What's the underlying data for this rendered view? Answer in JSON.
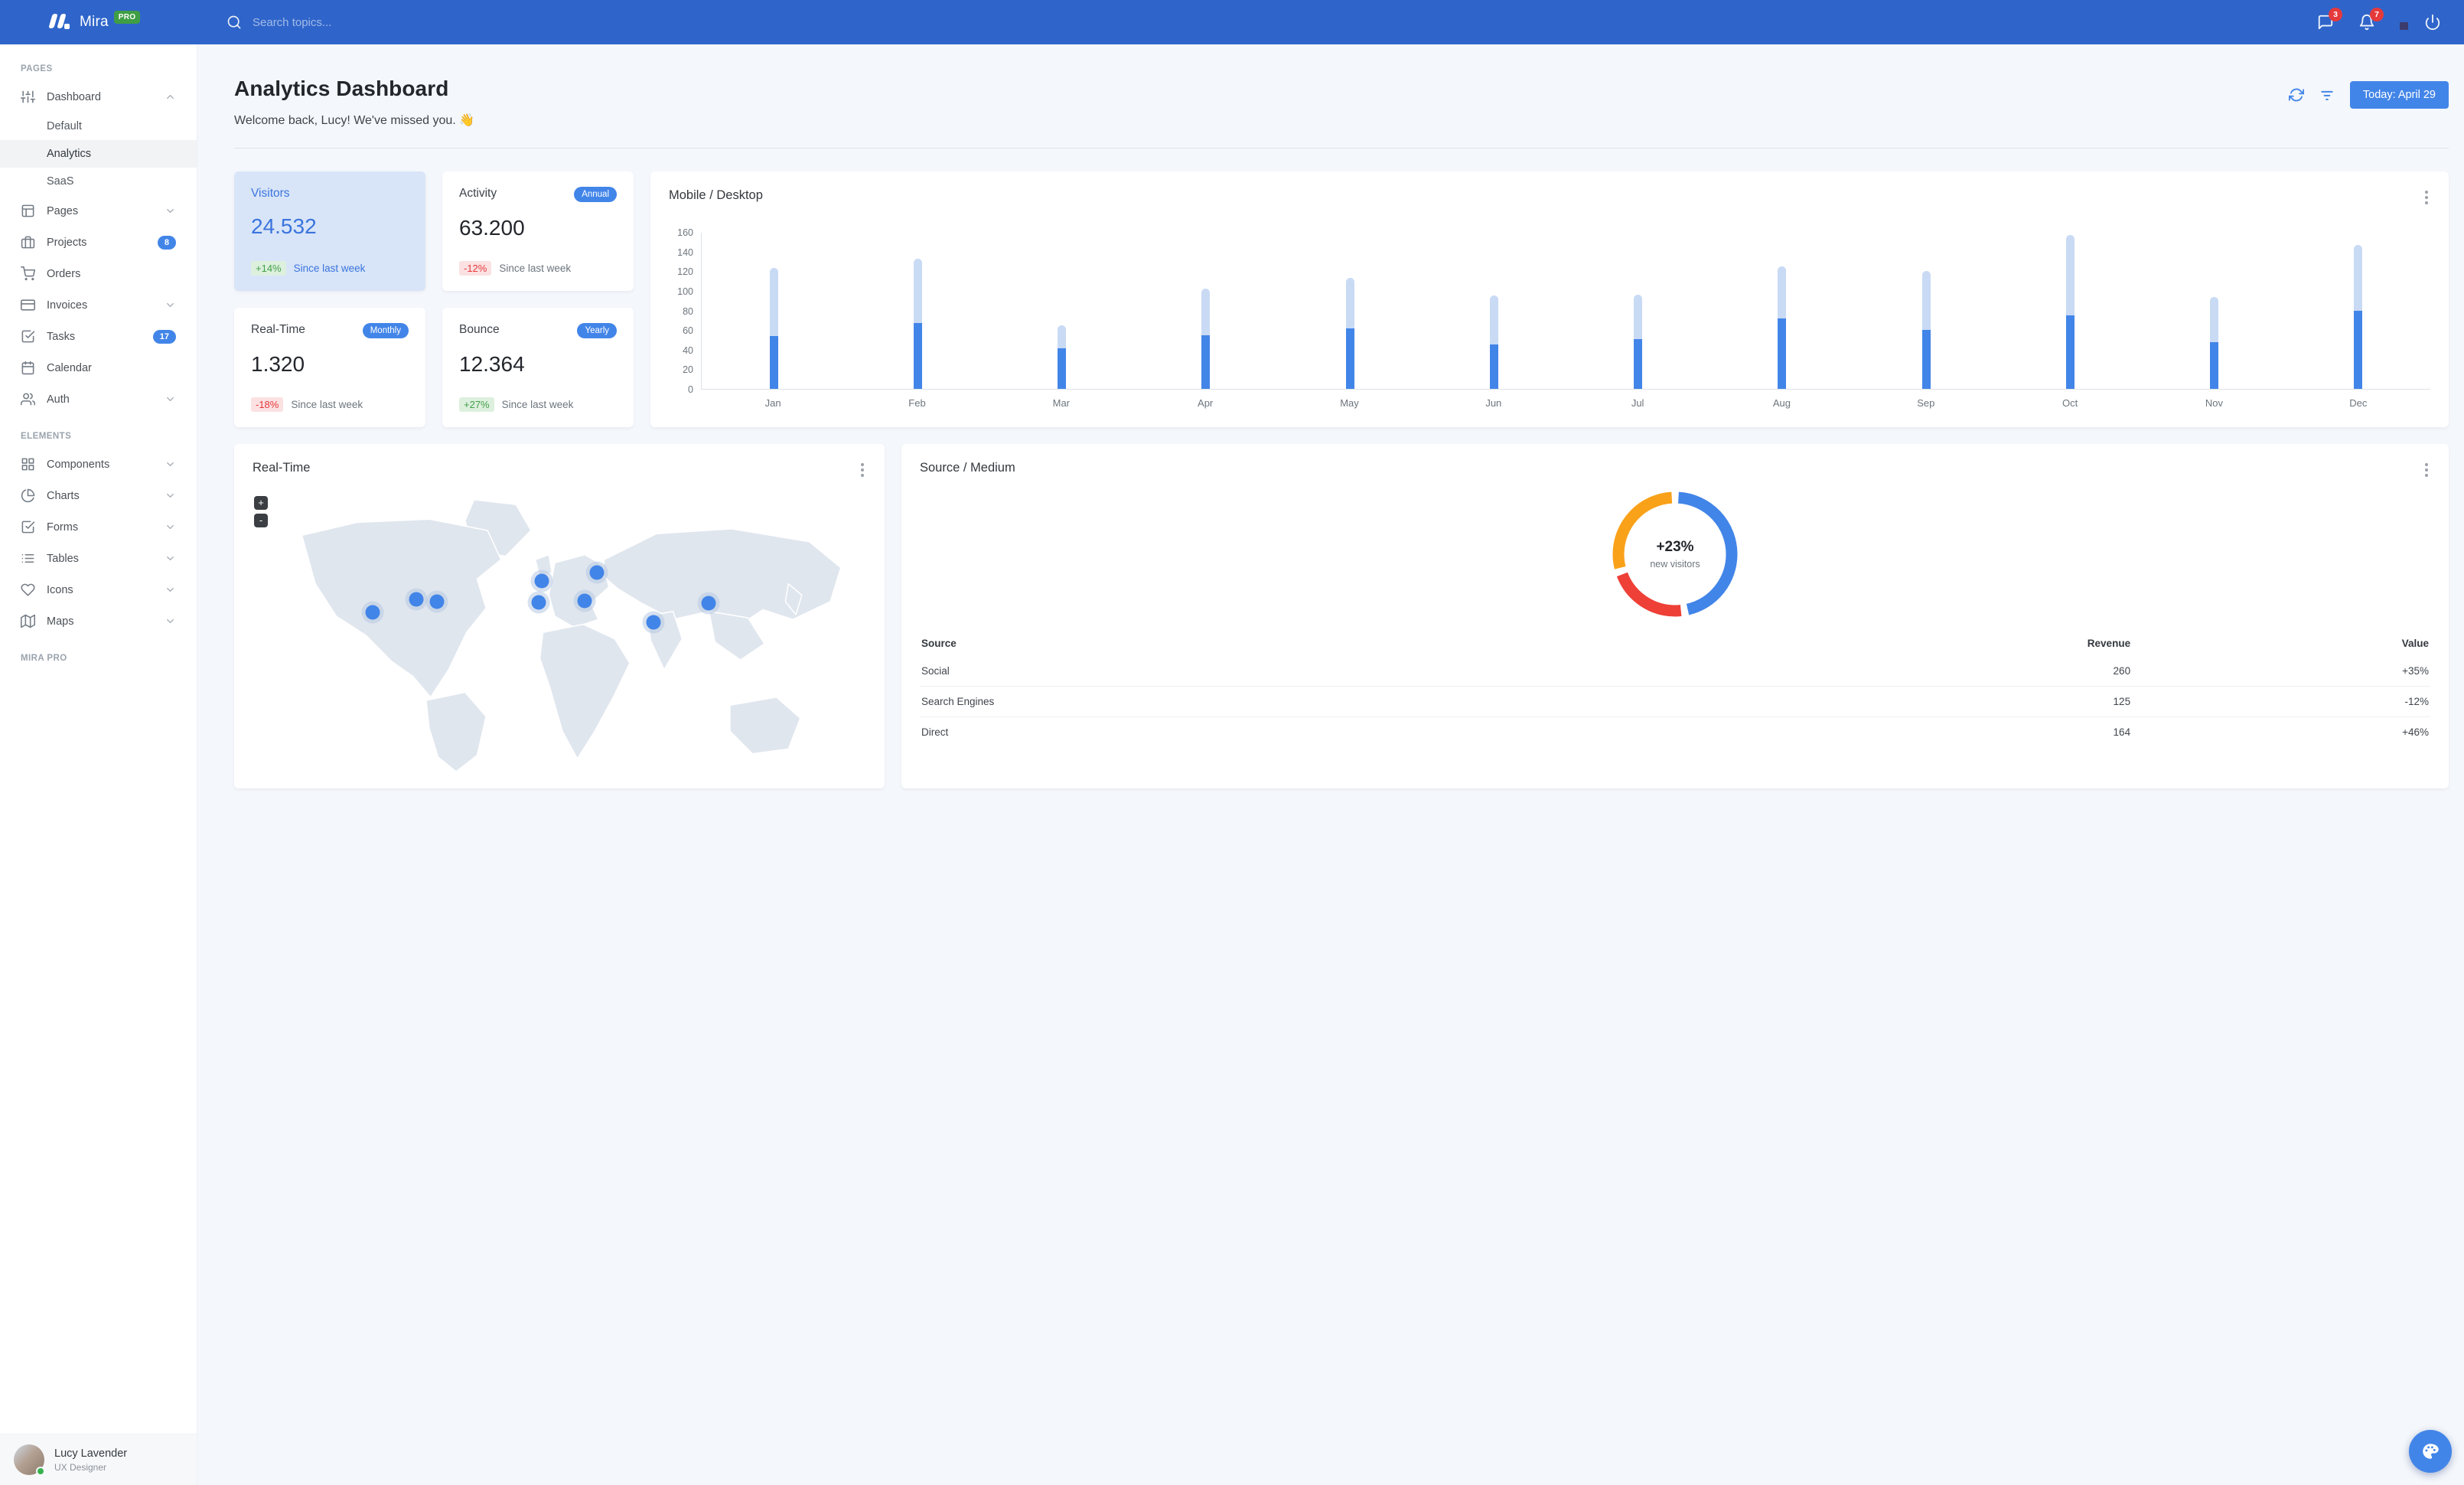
{
  "theme": {
    "primary": "#4285e8",
    "navbar": "#2f65ca",
    "success": "#47b14d",
    "danger": "#e5393c",
    "warning": "#f9a119"
  },
  "navbar": {
    "brand": "Mira",
    "brand_badge": "PRO",
    "search_placeholder": "Search topics...",
    "messages_count": "3",
    "notifications_count": "7"
  },
  "sidebar": {
    "sections": [
      {
        "label": "PAGES",
        "items": [
          {
            "icon": "sliders-icon",
            "label": "Dashboard",
            "chevron": "up",
            "children": [
              {
                "label": "Default",
                "active": false
              },
              {
                "label": "Analytics",
                "active": true
              },
              {
                "label": "SaaS",
                "active": false
              }
            ]
          },
          {
            "icon": "layout-icon",
            "label": "Pages",
            "chevron": "down"
          },
          {
            "icon": "briefcase-icon",
            "label": "Projects",
            "badge": "8"
          },
          {
            "icon": "cart-icon",
            "label": "Orders"
          },
          {
            "icon": "credit-card-icon",
            "label": "Invoices",
            "chevron": "down"
          },
          {
            "icon": "check-square-icon",
            "label": "Tasks",
            "badge": "17"
          },
          {
            "icon": "calendar-icon",
            "label": "Calendar"
          },
          {
            "icon": "users-icon",
            "label": "Auth",
            "chevron": "down"
          }
        ]
      },
      {
        "label": "ELEMENTS",
        "items": [
          {
            "icon": "grid-icon",
            "label": "Components",
            "chevron": "down"
          },
          {
            "icon": "pie-chart-icon",
            "label": "Charts",
            "chevron": "down"
          },
          {
            "icon": "check-square-icon",
            "label": "Forms",
            "chevron": "down"
          },
          {
            "icon": "list-icon",
            "label": "Tables",
            "chevron": "down"
          },
          {
            "icon": "heart-icon",
            "label": "Icons",
            "chevron": "down"
          },
          {
            "icon": "map-icon",
            "label": "Maps",
            "chevron": "down"
          }
        ]
      },
      {
        "label": "MIRA PRO",
        "items": []
      }
    ],
    "user": {
      "name": "Lucy Lavender",
      "role": "UX Designer"
    }
  },
  "header": {
    "title": "Analytics Dashboard",
    "welcome": "Welcome back, Lucy! We've missed you. 👋",
    "date_button": "Today: April 29"
  },
  "stats": [
    {
      "title": "Visitors",
      "value": "24.532",
      "delta": "+14%",
      "delta_dir": "up",
      "note": "Since last week",
      "highlight": true
    },
    {
      "title": "Activity",
      "badge": "Annual",
      "value": "63.200",
      "delta": "-12%",
      "delta_dir": "down",
      "note": "Since last week",
      "highlight": false
    },
    {
      "title": "Real-Time",
      "badge": "Monthly",
      "value": "1.320",
      "delta": "-18%",
      "delta_dir": "down",
      "note": "Since last week",
      "highlight": false
    },
    {
      "title": "Bounce",
      "badge": "Yearly",
      "value": "12.364",
      "delta": "+27%",
      "delta_dir": "up",
      "note": "Since last week",
      "highlight": false
    }
  ],
  "chart_data": [
    {
      "type": "bar",
      "stacked": true,
      "title": "Mobile / Desktop",
      "categories": [
        "Jan",
        "Feb",
        "Mar",
        "Apr",
        "May",
        "Jun",
        "Jul",
        "Aug",
        "Sep",
        "Oct",
        "Nov",
        "Dec"
      ],
      "series": [
        {
          "name": "Mobile",
          "color": "#4285e8",
          "values": [
            54,
            67,
            41,
            55,
            62,
            45,
            51,
            72,
            60,
            75,
            48,
            80
          ]
        },
        {
          "name": "Desktop",
          "color": "#c9daf5",
          "values": [
            69,
            66,
            24,
            47,
            51,
            50,
            45,
            53,
            60,
            82,
            46,
            67
          ]
        }
      ],
      "xlabel": "",
      "ylabel": "",
      "ylim": [
        0,
        160
      ],
      "ytick_step": 20,
      "grid": false,
      "legend": "none"
    },
    {
      "type": "donut",
      "title": "Source / Medium",
      "center_value": "+23%",
      "center_label": "new visitors",
      "slices": [
        {
          "label": "Social",
          "value": 260,
          "color": "#4285e8"
        },
        {
          "label": "Search Engines",
          "value": 125,
          "color": "#ee4037"
        },
        {
          "label": "Direct",
          "value": 164,
          "color": "#f9a119"
        }
      ],
      "legend": "none"
    }
  ],
  "map_card": {
    "title": "Real-Time",
    "zoom_in": "+",
    "zoom_out": "-",
    "markers": [
      {
        "x": 19.6,
        "y": 43.8
      },
      {
        "x": 26.7,
        "y": 39.1
      },
      {
        "x": 30.0,
        "y": 40.0
      },
      {
        "x": 47.1,
        "y": 32.8
      },
      {
        "x": 46.6,
        "y": 40.3
      },
      {
        "x": 56.1,
        "y": 29.6
      },
      {
        "x": 54.1,
        "y": 39.7
      },
      {
        "x": 65.3,
        "y": 47.2
      },
      {
        "x": 74.3,
        "y": 40.6
      }
    ]
  },
  "source_table": {
    "columns": [
      "Source",
      "Revenue",
      "Value"
    ],
    "rows": [
      {
        "source": "Social",
        "revenue": "260",
        "value": "+35%"
      },
      {
        "source": "Search Engines",
        "revenue": "125",
        "value": "-12%"
      },
      {
        "source": "Direct",
        "revenue": "164",
        "value": "+46%"
      }
    ]
  }
}
